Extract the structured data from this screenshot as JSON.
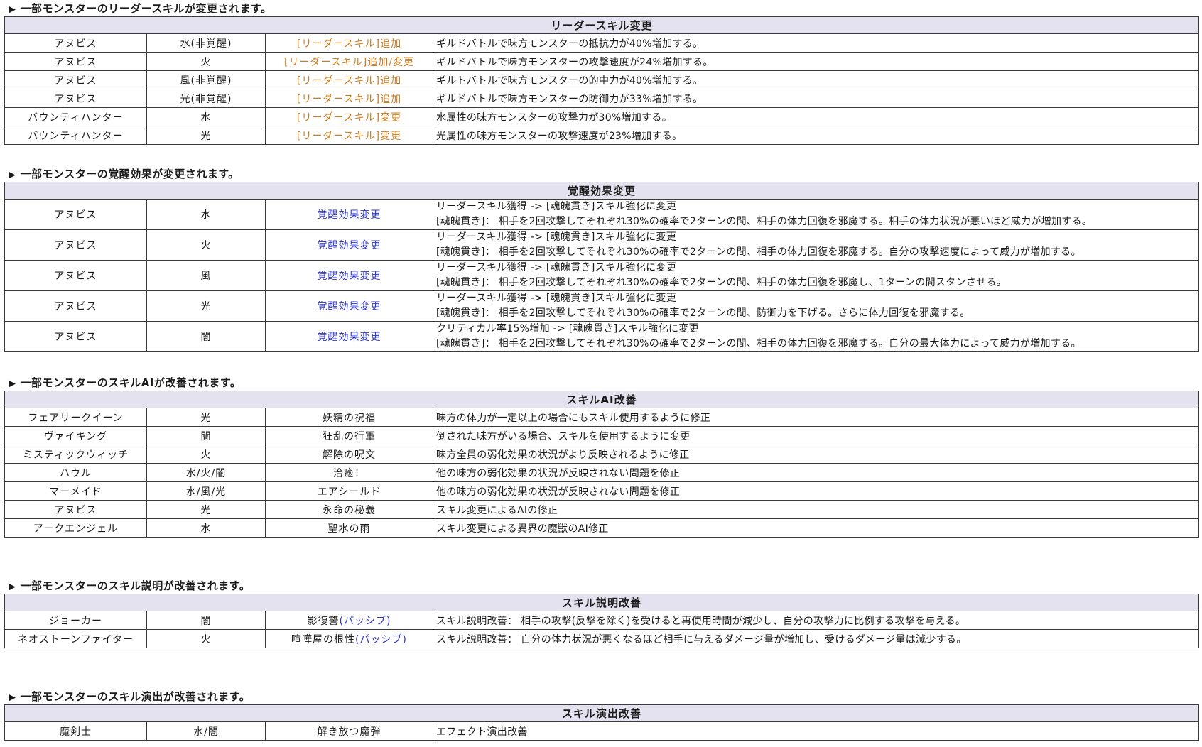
{
  "sections": [
    {
      "heading": "一部モンスターのリーダースキルが変更されます。",
      "title": "リーダースキル変更",
      "rows": [
        {
          "name": "アヌビス",
          "attr": "水(非覚醒)",
          "type": "[リーダースキル]追加",
          "desc": "ギルドバトルで味方モンスターの抵抗力が40%増加する。"
        },
        {
          "name": "アヌビス",
          "attr": "火",
          "type": "[リーダースキル]追加/変更",
          "desc": "ギルドバトルで味方モンスターの攻撃速度が24%増加する。"
        },
        {
          "name": "アヌビス",
          "attr": "風(非覚醒)",
          "type": "[リーダースキル]追加",
          "desc": "ギルトバトルで味方モンスターの的中力が40%増加する。"
        },
        {
          "name": "アヌビス",
          "attr": "光(非覚醒)",
          "type": "[リーダースキル]追加",
          "desc": "ギルドバトルで味方モンスターの防御力が33%増加する。"
        },
        {
          "name": "バウンティハンター",
          "attr": "水",
          "type": "[リーダースキル]変更",
          "desc": "水属性の味方モンスターの攻撃力が30%増加する。"
        },
        {
          "name": "バウンティハンター",
          "attr": "光",
          "type": "[リーダースキル]変更",
          "desc": "光属性の味方モンスターの攻撃速度が23%増加する。"
        }
      ]
    },
    {
      "heading": "一部モンスターの覚醒効果が変更されます。",
      "title": "覚醒効果変更",
      "rows": [
        {
          "name": "アヌビス",
          "attr": "水",
          "type": "覚醒効果変更",
          "desc1": "リーダースキル獲得 -> [魂魄貫き]スキル強化に変更",
          "desc2": "[魂魄貫き]： 相手を2回攻撃してそれぞれ30%の確率で2ターンの間、相手の体力回復を邪魔する。相手の体力状況が悪いほど威力が増加する。"
        },
        {
          "name": "アヌビス",
          "attr": "火",
          "type": "覚醒効果変更",
          "desc1": "リーダースキル獲得 -> [魂魄貫き]スキル強化に変更",
          "desc2": "[魂魄貫き]： 相手を2回攻撃してそれぞれ30%の確率で2ターンの間、相手の体力回復を邪魔する。自分の攻撃速度によって威力が増加する。"
        },
        {
          "name": "アヌビス",
          "attr": "風",
          "type": "覚醒効果変更",
          "desc1": "リーダースキル獲得 -> [魂魄貫き]スキル強化に変更",
          "desc2": "[魂魄貫き]： 相手を2回攻撃してそれぞれ30%の確率で2ターンの間、相手の体力回復を邪魔し、1ターンの間スタンさせる。"
        },
        {
          "name": "アヌビス",
          "attr": "光",
          "type": "覚醒効果変更",
          "desc1": "リーダースキル獲得 -> [魂魄貫き]スキル強化に変更",
          "desc2": "[魂魄貫き]： 相手を2回攻撃してそれぞれ30%の確率で2ターンの間、防御力を下げる。さらに体力回復を邪魔する。"
        },
        {
          "name": "アヌビス",
          "attr": "闇",
          "type": "覚醒効果変更",
          "desc1": "クリティカル率15%増加 -> [魂魄貫き]スキル強化に変更",
          "desc2": "[魂魄貫き]： 相手を2回攻撃してそれぞれ30%の確率で2ターンの間、相手の体力回復を邪魔する。自分の最大体力によって威力が増加する。"
        }
      ]
    },
    {
      "heading": "一部モンスターのスキルAIが改善されます。",
      "title": "スキルAI改善",
      "rows": [
        {
          "name": "フェアリークイーン",
          "attr": "光",
          "type": "妖精の祝福",
          "desc": "味方の体力が一定以上の場合にもスキル使用するように修正"
        },
        {
          "name": "ヴァイキング",
          "attr": "闇",
          "type": "狂乱の行軍",
          "desc": "倒された味方がいる場合、スキルを使用するように変更"
        },
        {
          "name": "ミスティックウィッチ",
          "attr": "火",
          "type": "解除の呪文",
          "desc": "味方全員の弱化効果の状況がより反映されるように修正"
        },
        {
          "name": "ハウル",
          "attr": "水/火/闇",
          "type": "治癒！",
          "desc": "他の味方の弱化効果の状況が反映されない問題を修正"
        },
        {
          "name": "マーメイド",
          "attr": "水/風/光",
          "type": "エアシールド",
          "desc": "他の味方の弱化効果の状況が反映されない問題を修正"
        },
        {
          "name": "アヌビス",
          "attr": "光",
          "type": "永命の秘義",
          "desc": "スキル変更によるAIの修正"
        },
        {
          "name": "アークエンジェル",
          "attr": "水",
          "type": "聖水の雨",
          "desc": "スキル変更による異界の魔獣のAI修正"
        }
      ]
    },
    {
      "heading": "一部モンスターのスキル説明が改善されます。",
      "title": "スキル説明改善",
      "rows": [
        {
          "name": "ジョーカー",
          "attr": "闇",
          "type": "影復讐",
          "type_suffix": "(パッシブ)",
          "desc": "スキル説明改善： 相手の攻撃(反撃を除く)を受けると再使用時間が減少し、自分の攻撃力に比例する攻撃を与える。"
        },
        {
          "name": "ネオストーンファイター",
          "attr": "火",
          "type": "喧嘩屋の根性",
          "type_suffix": "(パッシブ)",
          "desc": "スキル説明改善： 自分の体力状況が悪くなるほど相手に与えるダメージ量が増加し、受けるダメージ量は減少する。"
        }
      ]
    },
    {
      "heading": "一部モンスターのスキル演出が改善されます。",
      "title": "スキル演出改善",
      "rows": [
        {
          "name": "魔剣士",
          "attr": "水/闇",
          "type": "解き放つ魔弾",
          "desc": "エフェクト演出改善"
        }
      ]
    }
  ],
  "colors": {
    "header_bg": "#e5e2ef",
    "orange": "#d07b1a",
    "blue": "#2c35c7"
  },
  "icons": {
    "heading_bullet": "▶"
  }
}
